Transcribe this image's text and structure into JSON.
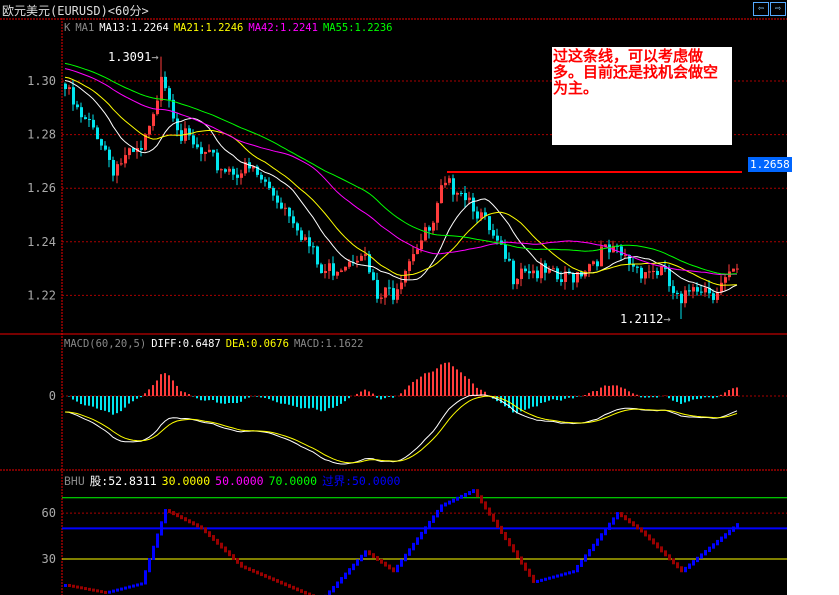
{
  "header": {
    "title": "欧元美元(EURUSD)<60分>",
    "nav_prev": "⇦",
    "nav_next": "⇨"
  },
  "main_legend": {
    "k": "K",
    "ma1": "MA1",
    "ma13": "MA13:1.2264",
    "ma21": "MA21:1.2246",
    "ma42": "MA42:1.2241",
    "ma55": "MA55:1.2236"
  },
  "macd_legend": {
    "name": "MACD(60,20,5)",
    "diff": "DIFF:0.6487",
    "dea": "DEA:0.0676",
    "macd": "MACD:1.1622"
  },
  "bhu_legend": {
    "name": "BHU",
    "gu": "股:52.8311",
    "l30": "30.0000",
    "l50": "50.0000",
    "l70": "70.0000",
    "cross": "过界:50.0000"
  },
  "annotations": {
    "high": "1.3091",
    "low": "1.2112",
    "line_price": "1.2658",
    "note": "过这条线，可以考虑做多。目前还是找机会做空为主。"
  },
  "colors": {
    "up": "#ff3c3c",
    "down": "#00e5ee",
    "ma13": "#ffffff",
    "ma21": "#ffff00",
    "ma42": "#ff00ff",
    "ma55": "#00ff00"
  },
  "chart_data": [
    {
      "type": "candlestick",
      "title": "欧元美元(EURUSD)<60分>",
      "ylim": [
        1.205,
        1.315
      ],
      "yticks": [
        "1.30",
        "1.28",
        "1.26",
        "1.24",
        "1.22"
      ],
      "close_keypoints": [
        [
          0,
          1.297
        ],
        [
          4,
          1.285
        ],
        [
          8,
          1.281
        ],
        [
          12,
          1.268
        ],
        [
          14,
          1.27
        ],
        [
          19,
          1.273
        ],
        [
          22,
          1.285
        ],
        [
          24,
          1.305
        ],
        [
          27,
          1.29
        ],
        [
          29,
          1.28
        ],
        [
          34,
          1.272
        ],
        [
          39,
          1.268
        ],
        [
          47,
          1.266
        ],
        [
          52,
          1.258
        ],
        [
          57,
          1.25
        ],
        [
          62,
          1.235
        ],
        [
          64,
          1.228
        ],
        [
          69,
          1.232
        ],
        [
          74,
          1.238
        ],
        [
          78,
          1.218
        ],
        [
          82,
          1.222
        ],
        [
          87,
          1.238
        ],
        [
          92,
          1.245
        ],
        [
          94,
          1.258
        ],
        [
          98,
          1.262
        ],
        [
          102,
          1.255
        ],
        [
          107,
          1.24
        ],
        [
          112,
          1.228
        ],
        [
          114,
          1.232
        ],
        [
          119,
          1.228
        ],
        [
          124,
          1.225
        ],
        [
          129,
          1.23
        ],
        [
          134,
          1.236
        ],
        [
          138,
          1.235
        ],
        [
          144,
          1.23
        ],
        [
          149,
          1.229
        ],
        [
          154,
          1.215
        ],
        [
          157,
          1.225
        ],
        [
          162,
          1.222
        ],
        [
          168,
          1.228
        ]
      ]
    },
    {
      "type": "line",
      "title": "MACD(60,20,5)",
      "yticks": [
        "0"
      ]
    },
    {
      "type": "line",
      "title": "BHU",
      "yticks": [
        "60",
        "30"
      ],
      "ylim": [
        0,
        80
      ],
      "hlines": [
        70,
        60,
        50,
        30
      ],
      "keypoints": [
        [
          0,
          13
        ],
        [
          10,
          8
        ],
        [
          19,
          14
        ],
        [
          25,
          62
        ],
        [
          34,
          50
        ],
        [
          44,
          25
        ],
        [
          64,
          3
        ],
        [
          75,
          35
        ],
        [
          82,
          22
        ],
        [
          94,
          65
        ],
        [
          102,
          75
        ],
        [
          112,
          35
        ],
        [
          117,
          15
        ],
        [
          127,
          22
        ],
        [
          138,
          60
        ],
        [
          144,
          48
        ],
        [
          154,
          22
        ],
        [
          168,
          52.8
        ]
      ]
    }
  ]
}
